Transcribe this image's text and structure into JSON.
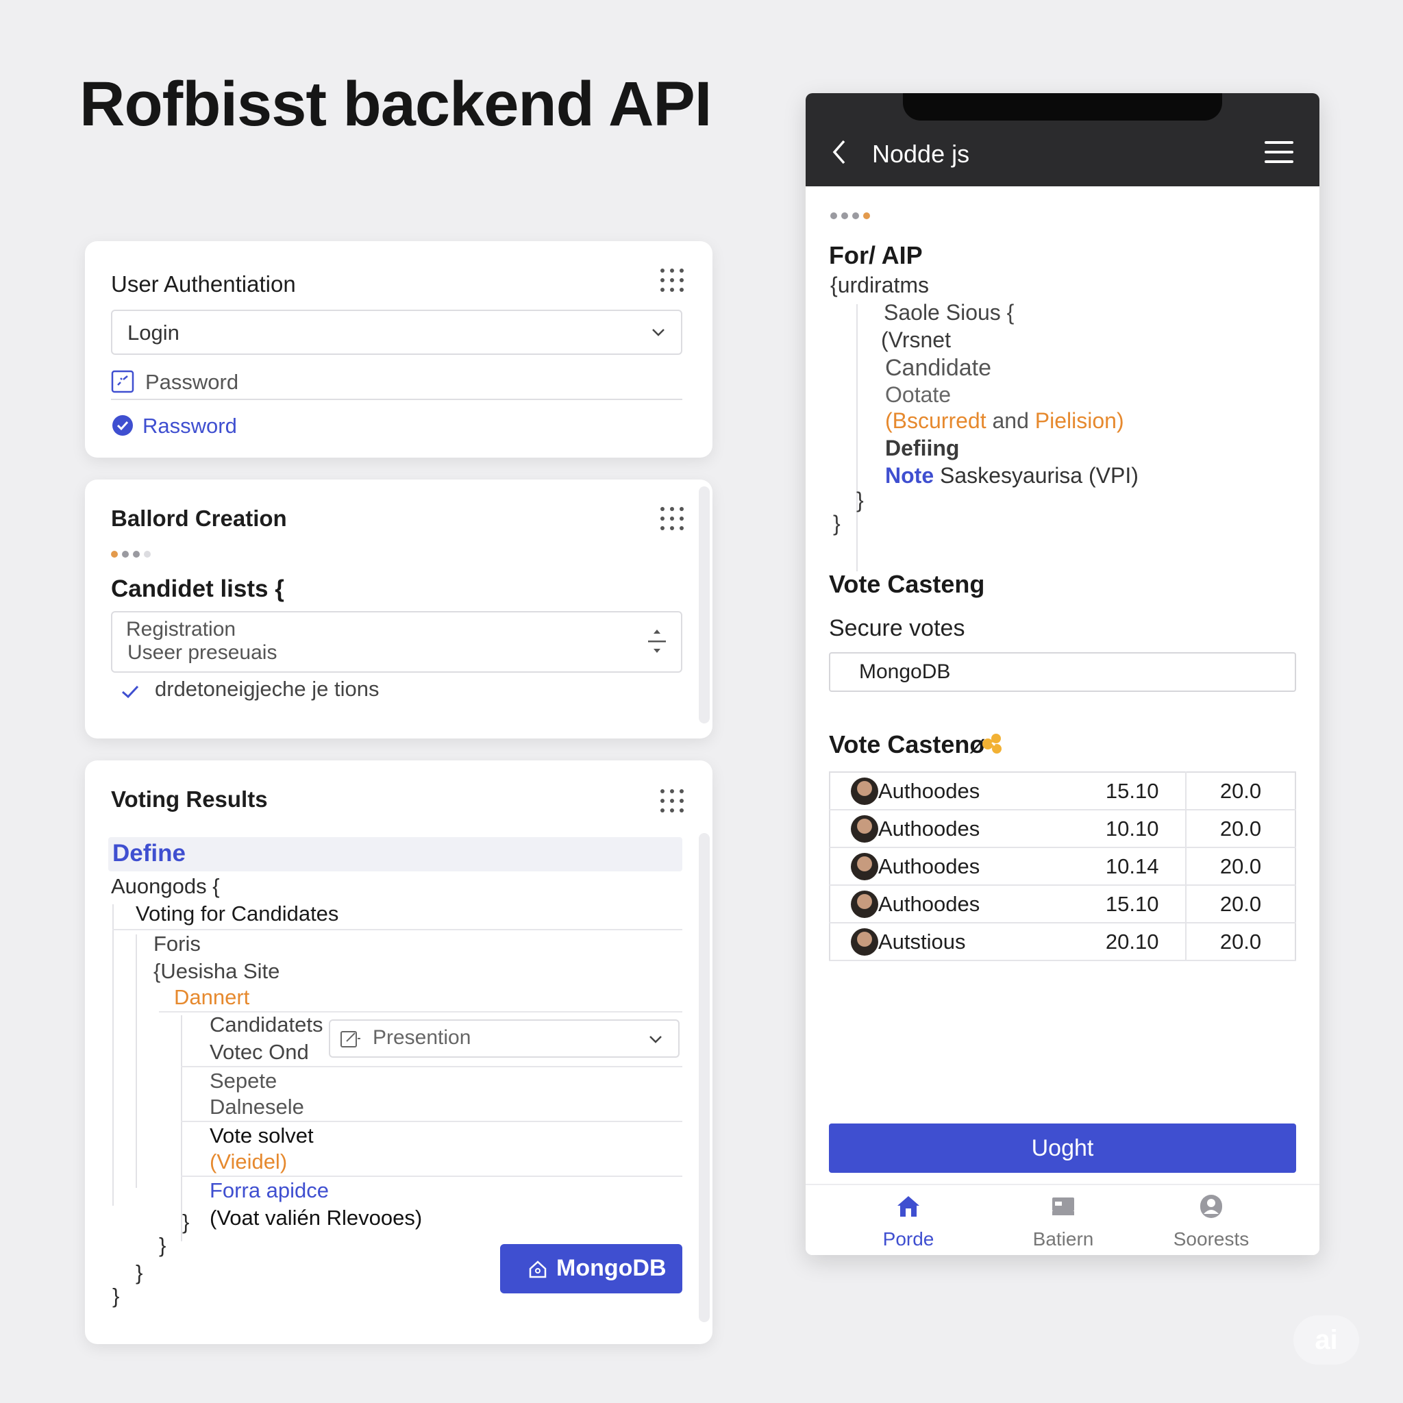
{
  "page": {
    "title": "Rofbisst backend API"
  },
  "auth": {
    "title": "User Authentiation",
    "select_value": "Login",
    "password_label": "Password",
    "link_label": "Rassword"
  },
  "ballot": {
    "title": "Ballord Creation",
    "list_heading": "Candidet lists {",
    "textarea_line1": "Registration",
    "textarea_line2": "Useer preseuais",
    "check_label": "drdetoneigjeche je tions"
  },
  "results": {
    "title": "Voting Results",
    "define_label": "Define",
    "lines": {
      "l1": "Auongods {",
      "l2": "Voting for Candidates",
      "l3": "Foris",
      "l4": "{Uesisha Site",
      "l5": "Dannert",
      "l6": "Candidatets",
      "l7": "Votec Ond",
      "l8": "Sepete",
      "l9": "Dalnesele",
      "l10": "Vote solvet",
      "l11": "(Vieidel)",
      "l12": "Forra apidce",
      "l13": "(Voat valién Rlevooes)"
    },
    "braces": [
      "}",
      "}",
      "}",
      "}"
    ],
    "select_value": "Presention",
    "button_label": "MongoDB"
  },
  "phone": {
    "header_title": "Nodde js",
    "code_heading": "For/ AIP",
    "code": {
      "c1": "{urdiratms",
      "c2": "Saole Sious {",
      "c3": "(Vrsnet",
      "c4": "Candidate",
      "c5": "Ootate",
      "c6a": "(Bscurredt",
      "c6b": " and ",
      "c6c": "Pielision)",
      "c7": "Defiing",
      "c8a": "Note",
      "c8b": " Saskesyaurisa (VPI)",
      "c9": "}",
      "c10": "}"
    },
    "section1_title": "Vote Casteng",
    "section1_sub": "Secure votes",
    "input_value": "MongoDB",
    "section2_title": "Vote Castenø",
    "rows": [
      {
        "name": "Authoodes",
        "a": "15.10",
        "b": "20.0"
      },
      {
        "name": "Authoodes",
        "a": "10.10",
        "b": "20.0"
      },
      {
        "name": "Authoodes",
        "a": "10.14",
        "b": "20.0"
      },
      {
        "name": "Authoodes",
        "a": "15.10",
        "b": "20.0"
      },
      {
        "name": "Autstious",
        "a": "20.10",
        "b": "20.0"
      }
    ],
    "primary_button": "Uoght",
    "tabs": [
      {
        "label": "Porde",
        "icon": "home-icon"
      },
      {
        "label": "Batiern",
        "icon": "bed-icon"
      },
      {
        "label": "Soorests",
        "icon": "user-icon"
      }
    ]
  },
  "watermark": "ai",
  "colors": {
    "accent": "#3f4fd0",
    "orange": "#e6892e",
    "dark_bar": "#2b2b2d"
  }
}
